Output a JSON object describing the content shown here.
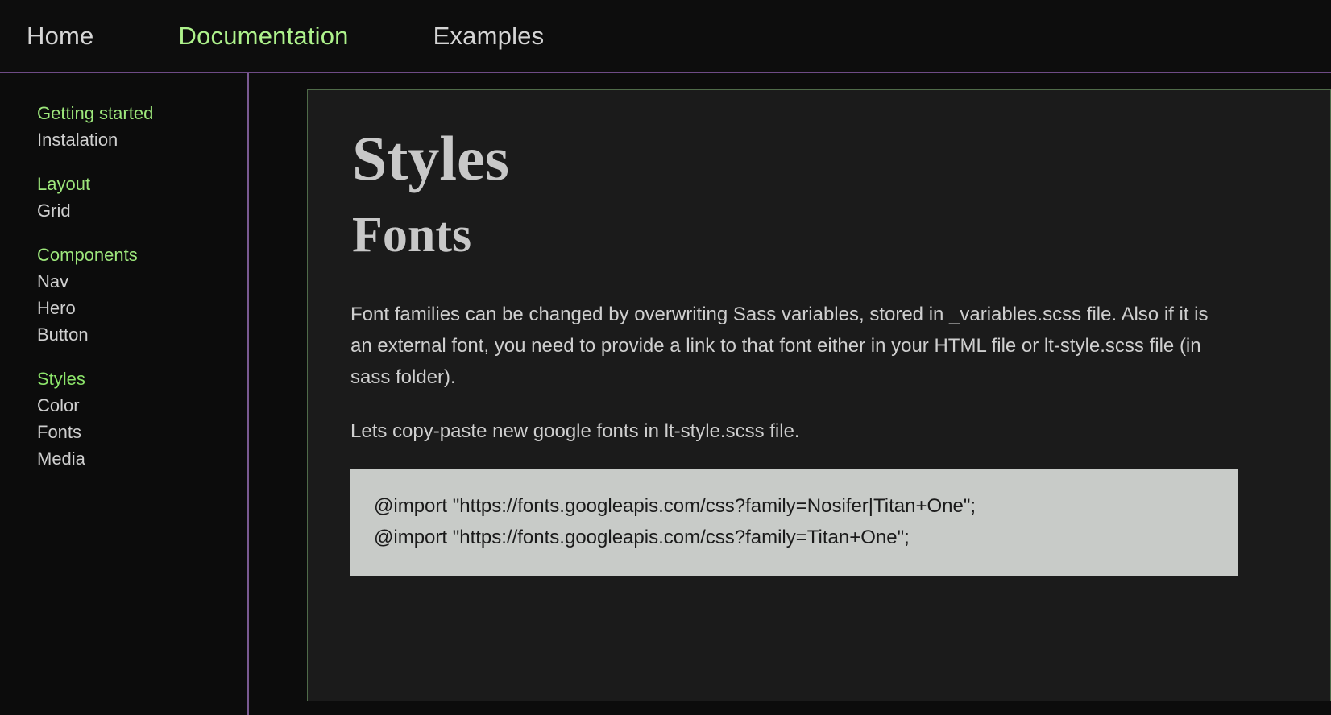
{
  "navbar": {
    "items": [
      {
        "label": "Home",
        "active": false
      },
      {
        "label": "Documentation",
        "active": true
      },
      {
        "label": "Examples",
        "active": false
      }
    ]
  },
  "sidebar": {
    "groups": [
      {
        "heading": "Getting started",
        "links": [
          {
            "label": "Instalation"
          }
        ]
      },
      {
        "heading": "Layout",
        "links": [
          {
            "label": "Grid"
          }
        ]
      },
      {
        "heading": "Components",
        "links": [
          {
            "label": "Nav"
          },
          {
            "label": "Hero"
          },
          {
            "label": "Button"
          }
        ]
      },
      {
        "heading": "Styles",
        "links": [
          {
            "label": "Color"
          },
          {
            "label": "Fonts"
          },
          {
            "label": "Media"
          }
        ]
      }
    ]
  },
  "main": {
    "title": "Styles",
    "subtitle": "Fonts",
    "paragraph1": "Font families can be changed by overwriting Sass variables, stored in _variables.scss file. Also if it is an external font, you need to provide a link to that font either in your HTML file or lt-style.scss file (in sass folder).",
    "paragraph2": "Lets copy-paste new google fonts in lt-style.scss file.",
    "code_lines": [
      "@import \"https://fonts.googleapis.com/css?family=Nosifer|Titan+One\";",
      "@import \"https://fonts.googleapis.com/css?family=Titan+One\";"
    ]
  },
  "colors": {
    "page_background": "#0c0c0c",
    "navbar_background": "#0d0d0d",
    "navbar_border": "#6e4b86",
    "sidebar_divider": "#7a5a92",
    "accent_green": "#9ee87c",
    "panel_background": "#1b1b1b",
    "panel_border": "#4f6b49",
    "code_background": "#c8cbc8",
    "body_text": "#cfcfcf"
  }
}
